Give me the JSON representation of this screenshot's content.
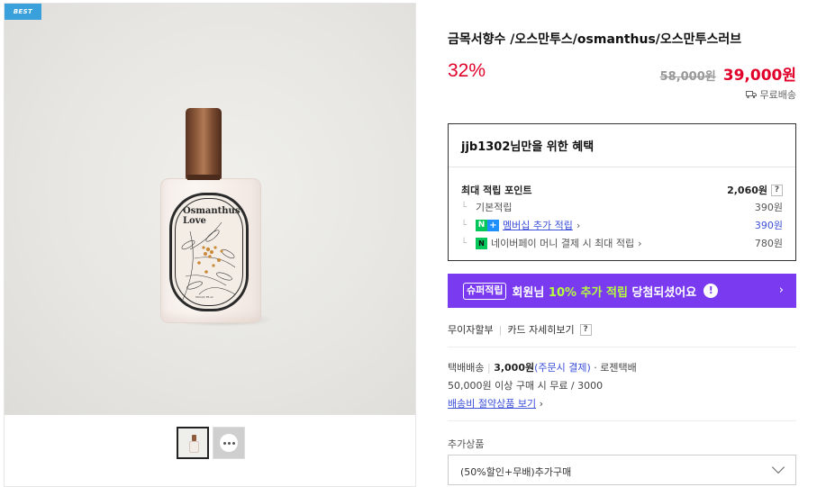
{
  "gallery": {
    "badge": "BEST",
    "label_line1": "Osmanthus",
    "label_line2": "Love",
    "label_small": "50ml/1.7fl.oz"
  },
  "product": {
    "title": "금목서향수 /오스만투스/osmanthus/오스만투스러브",
    "discount": "32%",
    "original_price": "58,000원",
    "sale_price": "39,000원",
    "shipping_tag": "무료배송"
  },
  "benefit": {
    "heading": "jjb1302님만을 위한 혜택",
    "max_points_label": "최대 적립 포인트",
    "max_points_value": "2,060원",
    "help": "?",
    "rows": [
      {
        "label": "기본적립",
        "value": "390원"
      },
      {
        "label": "멤버십 추가 적립",
        "value": "390원"
      },
      {
        "label": "네이버페이 머니 결제 시 최대 적립",
        "value": "780원"
      }
    ]
  },
  "super_banner": {
    "tag": "슈퍼적립",
    "text_pre": "회원님",
    "text_hl": "10% 추가 적립",
    "text_post": "당첨되셨어요",
    "info": "!",
    "chevron": "›"
  },
  "installment": {
    "label": "무이자할부",
    "card_link": "카드 자세히보기",
    "help": "?"
  },
  "delivery": {
    "type": "택배배송",
    "fee": "3,000원",
    "fee_note": "(주문시 결제)",
    "carrier": "· 로젠택배",
    "condition": "50,000원 이상 구매 시 무료 / 3000",
    "saving_link": "배송비 절약상품 보기"
  },
  "addon": {
    "label": "추가상품",
    "selected": "(50%할인+무배)추가구매"
  },
  "colors": {
    "accent_red": "#e0002a",
    "purple": "#7a3bf0",
    "link_blue": "#3b4fd8",
    "naver_green": "#03c75a"
  }
}
